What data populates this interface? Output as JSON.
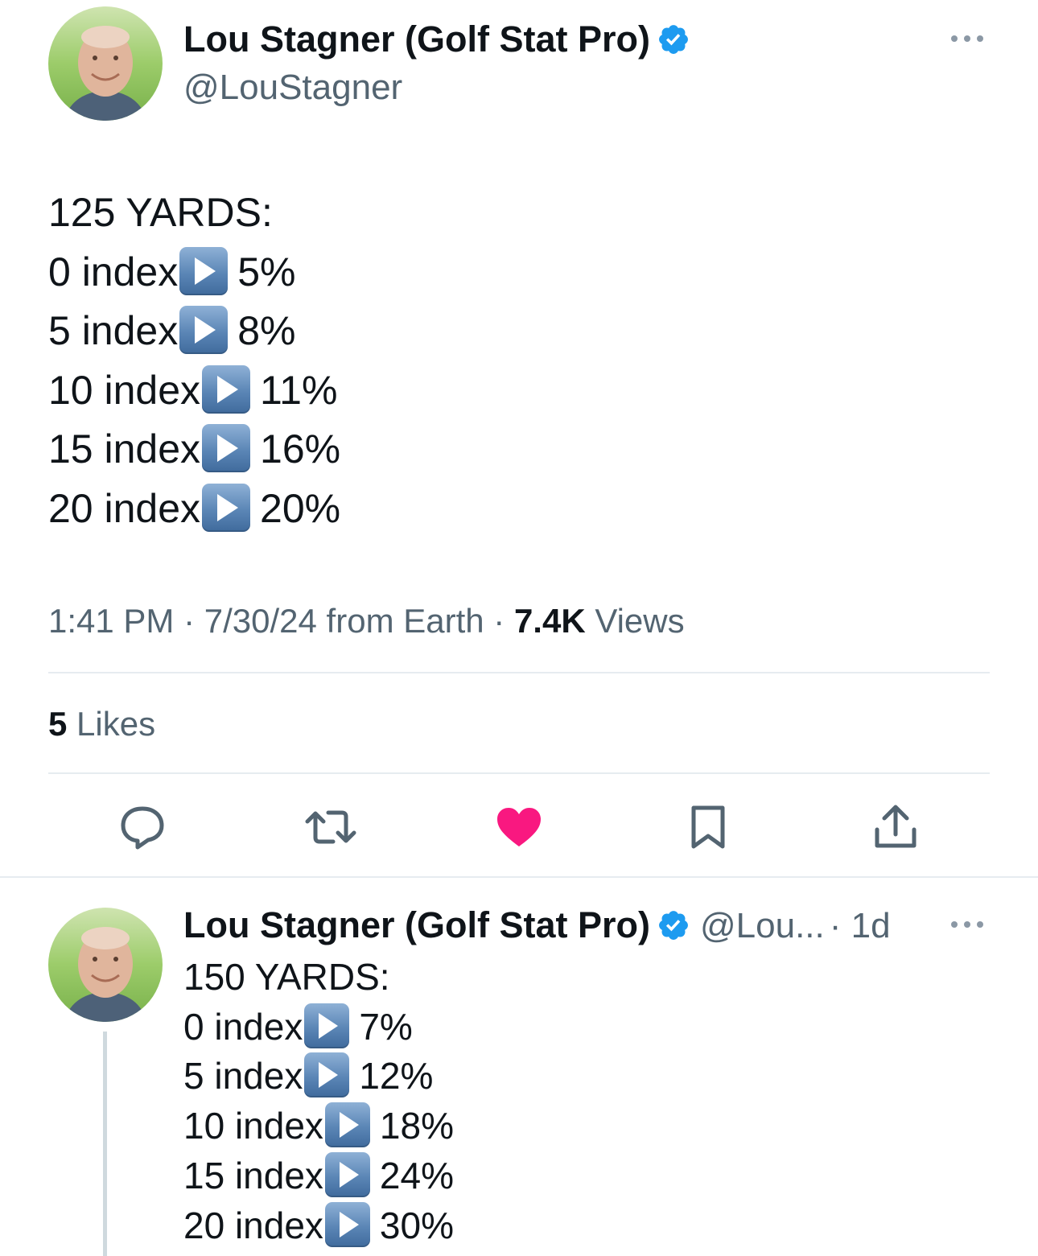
{
  "tweet": {
    "author_name": "Lou Stagner (Golf Stat Pro)",
    "handle": "@LouStagner",
    "more_label": "···",
    "lines": {
      "heading": "125 YARDS:",
      "r0": {
        "label": "0 index",
        "value": "5%"
      },
      "r1": {
        "label": "5 index",
        "value": "8%"
      },
      "r2": {
        "label": "10 index",
        "value": "11%"
      },
      "r3": {
        "label": "15 index",
        "value": "16%"
      },
      "r4": {
        "label": "20 index",
        "value": "20%"
      }
    },
    "time": "1:41 PM",
    "date": "7/30/24 from Earth",
    "views_count": "7.4K",
    "views_label": "Views",
    "separator": " · ",
    "likes_count": "5",
    "likes_label": "Likes"
  },
  "actions": {
    "reply": "reply-icon",
    "retweet": "retweet-icon",
    "like": "heart-icon",
    "bookmark": "bookmark-icon",
    "share": "share-icon",
    "like_color": "#f91880"
  },
  "reply": {
    "author_name": "Lou Stagner (Golf Stat Pro)",
    "handle": "@Lou...",
    "age": "· 1d",
    "more_label": "···",
    "lines": {
      "heading": "150 YARDS:",
      "r0": {
        "label": "0 index",
        "value": "7%"
      },
      "r1": {
        "label": "5 index",
        "value": "12%"
      },
      "r2": {
        "label": "10 index",
        "value": "18%"
      },
      "r3": {
        "label": "15 index",
        "value": "24%"
      },
      "r4": {
        "label": "20 index",
        "value": "30%"
      }
    }
  },
  "colors": {
    "verified": "#1d9bf0",
    "secondary_text": "#536471",
    "divider": "#e6ecf0"
  }
}
